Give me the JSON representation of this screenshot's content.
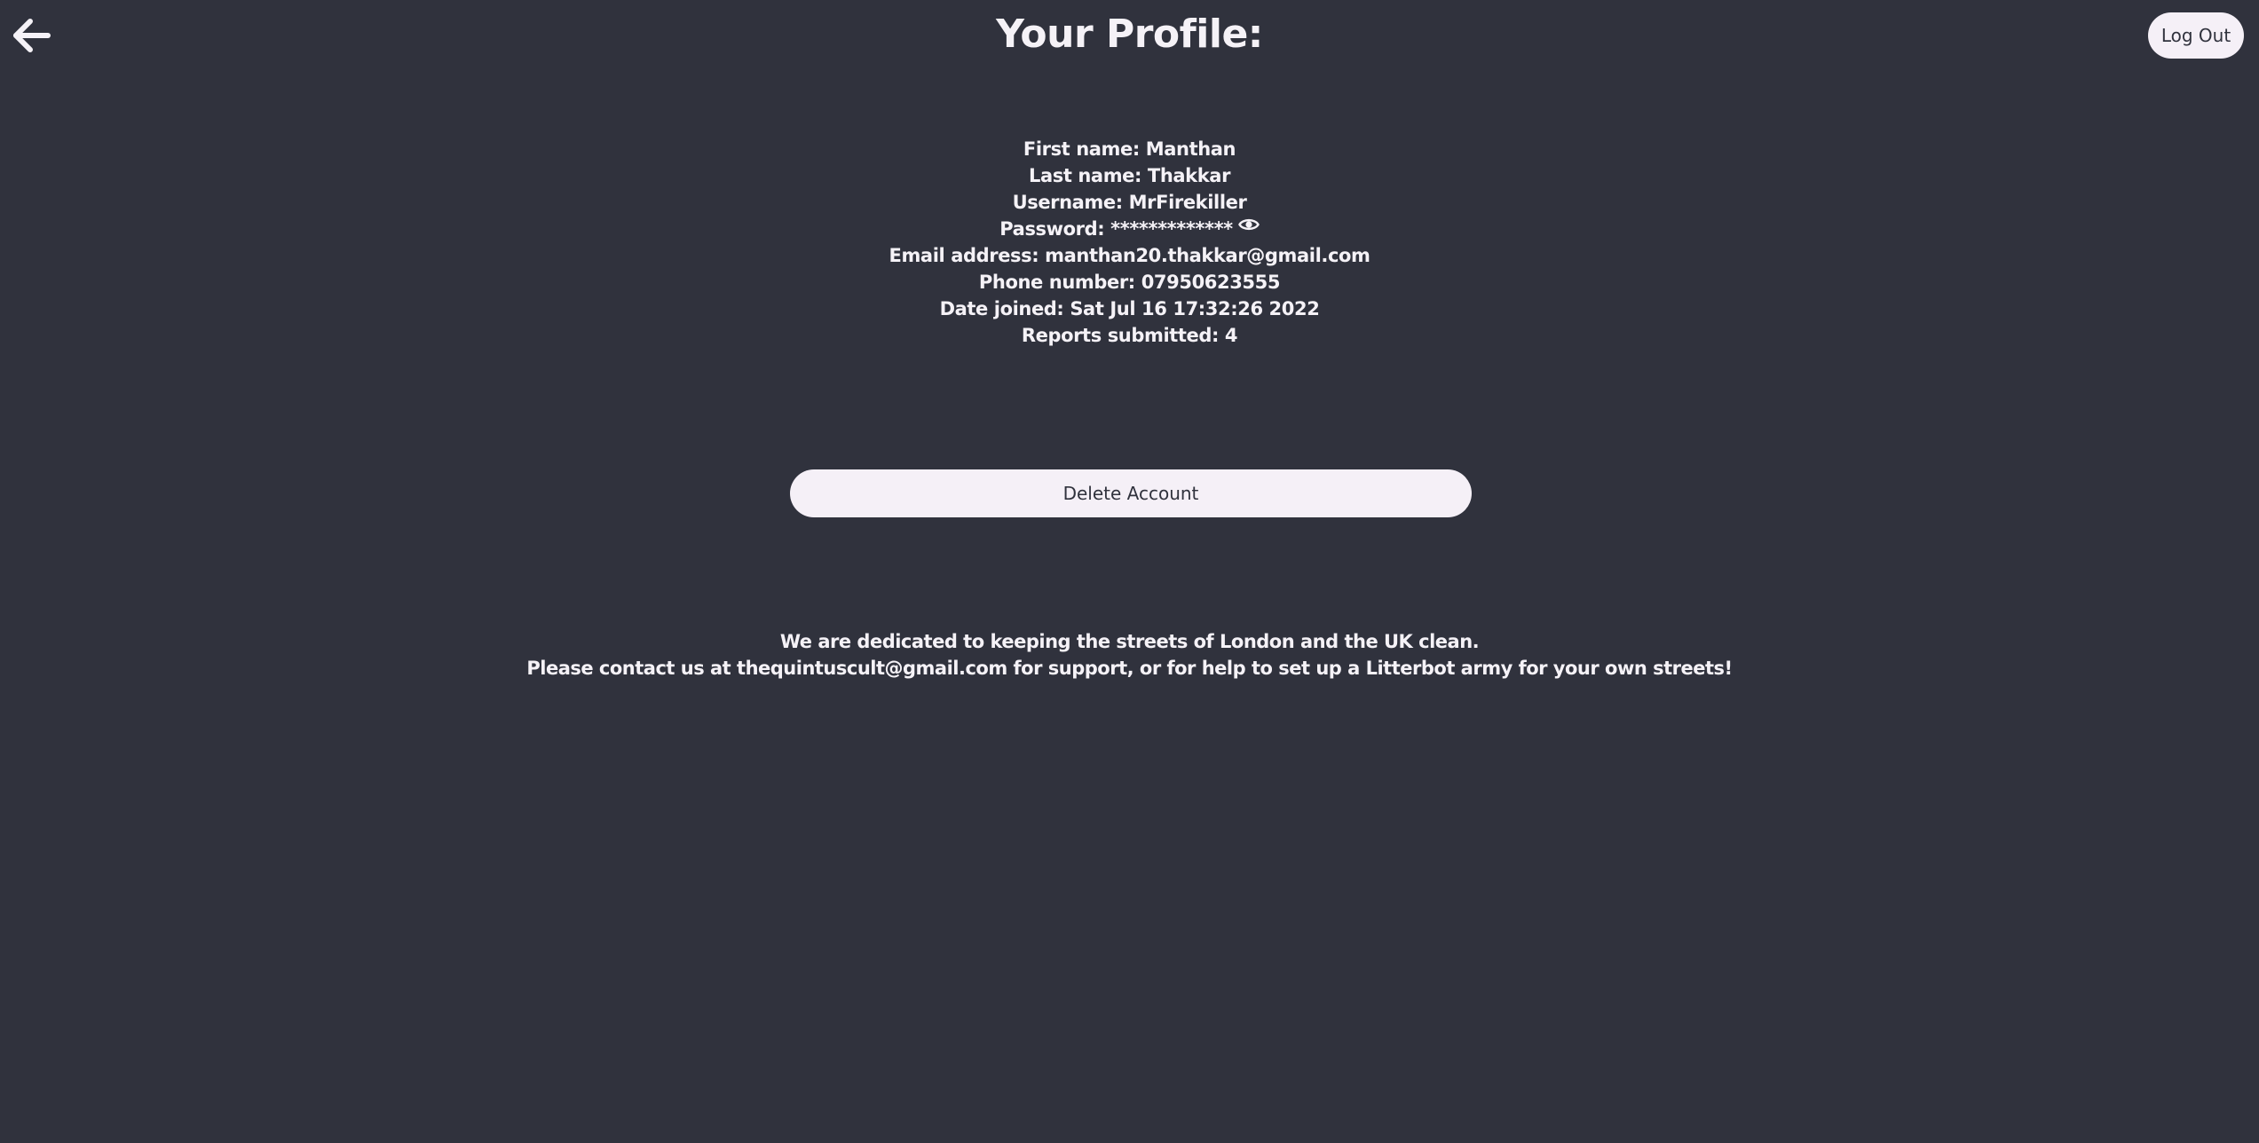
{
  "header": {
    "title": "Your Profile:",
    "back_icon": "arrow-left-icon",
    "logout_label": "Log Out"
  },
  "profile": {
    "first_name": "First name: Manthan",
    "last_name": "Last name: Thakkar",
    "username": "Username: MrFirekiller",
    "password": "Password: *************",
    "password_toggle_icon": "eye-icon",
    "email": "Email address: manthan20.thakkar@gmail.com",
    "phone": "Phone number: 07950623555",
    "date_joined": "Date joined: Sat Jul 16 17:32:26 2022",
    "reports_submitted": "Reports submitted: 4"
  },
  "actions": {
    "delete_account_label": "Delete Account"
  },
  "footer": {
    "line1": "We are dedicated to keeping the streets of London and the UK clean.",
    "line2": "Please contact us at thequintuscult@gmail.com for support, or for help to set up a Litterbot army for your own streets!"
  },
  "colors": {
    "background": "#30323d",
    "text": "#f5f2f7",
    "button_background": "#f5f0f7",
    "button_text": "#30323d"
  }
}
